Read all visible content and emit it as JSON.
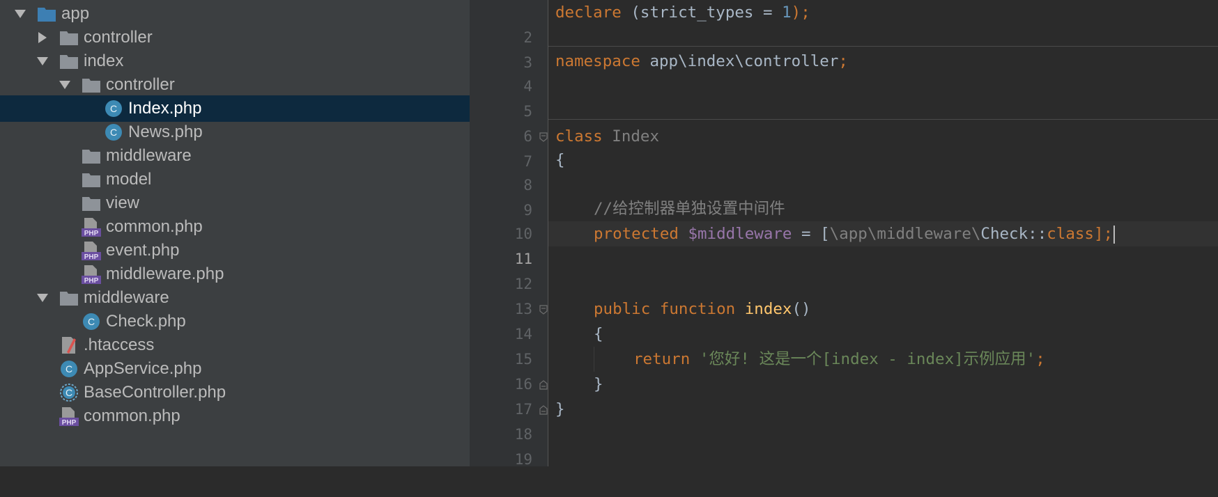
{
  "tree": [
    {
      "label": "app",
      "kind": "folder-blue",
      "arrow": "down"
    },
    {
      "label": "controller",
      "kind": "folder",
      "arrow": "right"
    },
    {
      "label": "index",
      "kind": "folder",
      "arrow": "down"
    },
    {
      "label": "controller",
      "kind": "folder",
      "arrow": "down"
    },
    {
      "label": "Index.php",
      "kind": "php-class",
      "arrow": "none",
      "selected": true
    },
    {
      "label": "News.php",
      "kind": "php-class",
      "arrow": "none"
    },
    {
      "label": "middleware",
      "kind": "folder",
      "arrow": "none"
    },
    {
      "label": "model",
      "kind": "folder",
      "arrow": "none"
    },
    {
      "label": "view",
      "kind": "folder",
      "arrow": "none"
    },
    {
      "label": "common.php",
      "kind": "php-file",
      "arrow": "none"
    },
    {
      "label": "event.php",
      "kind": "php-file",
      "arrow": "none"
    },
    {
      "label": "middleware.php",
      "kind": "php-file",
      "arrow": "none"
    },
    {
      "label": "middleware",
      "kind": "folder",
      "arrow": "down"
    },
    {
      "label": "Check.php",
      "kind": "php-class",
      "arrow": "none"
    },
    {
      "label": ".htaccess",
      "kind": "htaccess",
      "arrow": "none"
    },
    {
      "label": "AppService.php",
      "kind": "php-class",
      "arrow": "none"
    },
    {
      "label": "BaseController.php",
      "kind": "php-abstract",
      "arrow": "none"
    },
    {
      "label": "common.php",
      "kind": "php-file",
      "arrow": "none"
    }
  ],
  "php_badge": "PHP",
  "class_badge": "C",
  "editor": {
    "line_numbers": [
      "2",
      "3",
      "4",
      "5",
      "6",
      "7",
      "8",
      "9",
      "10",
      "11",
      "12",
      "13",
      "14",
      "15",
      "16",
      "17",
      "18",
      "19"
    ],
    "current_line": "11",
    "code": {
      "l2": {
        "kw": "declare",
        "rest": " (strict_types = ",
        "num": "1",
        "end": ");"
      },
      "l4": {
        "kw": "namespace",
        "rest": " app\\index\\controller",
        "end": ";"
      },
      "l7": {
        "kw": "class",
        "name": " Index"
      },
      "l8": "{",
      "l10": "//给控制器单独设置中间件",
      "l11": {
        "kw": "protected",
        "var": " $middleware",
        "eq": " = [",
        "fqn": "\\app\\middleware\\",
        "cls": "Check",
        "dc": "::",
        "kw2": "class",
        "end": "];"
      },
      "l14": {
        "kw": "public function",
        "fn": " index",
        "end": "()"
      },
      "l15": "{",
      "l16": {
        "kw": "return",
        "str": " '您好! 这是一个[index - index]示例应用'",
        "end": ";"
      },
      "l17": "}",
      "l18": "}"
    }
  },
  "colors": {
    "tree_bg": "#3c3f41",
    "selection": "#0d293e",
    "editor_bg": "#2b2b2b",
    "keyword": "#cc7832",
    "string": "#6a8759",
    "variable": "#9876aa",
    "function": "#ffc66d"
  }
}
